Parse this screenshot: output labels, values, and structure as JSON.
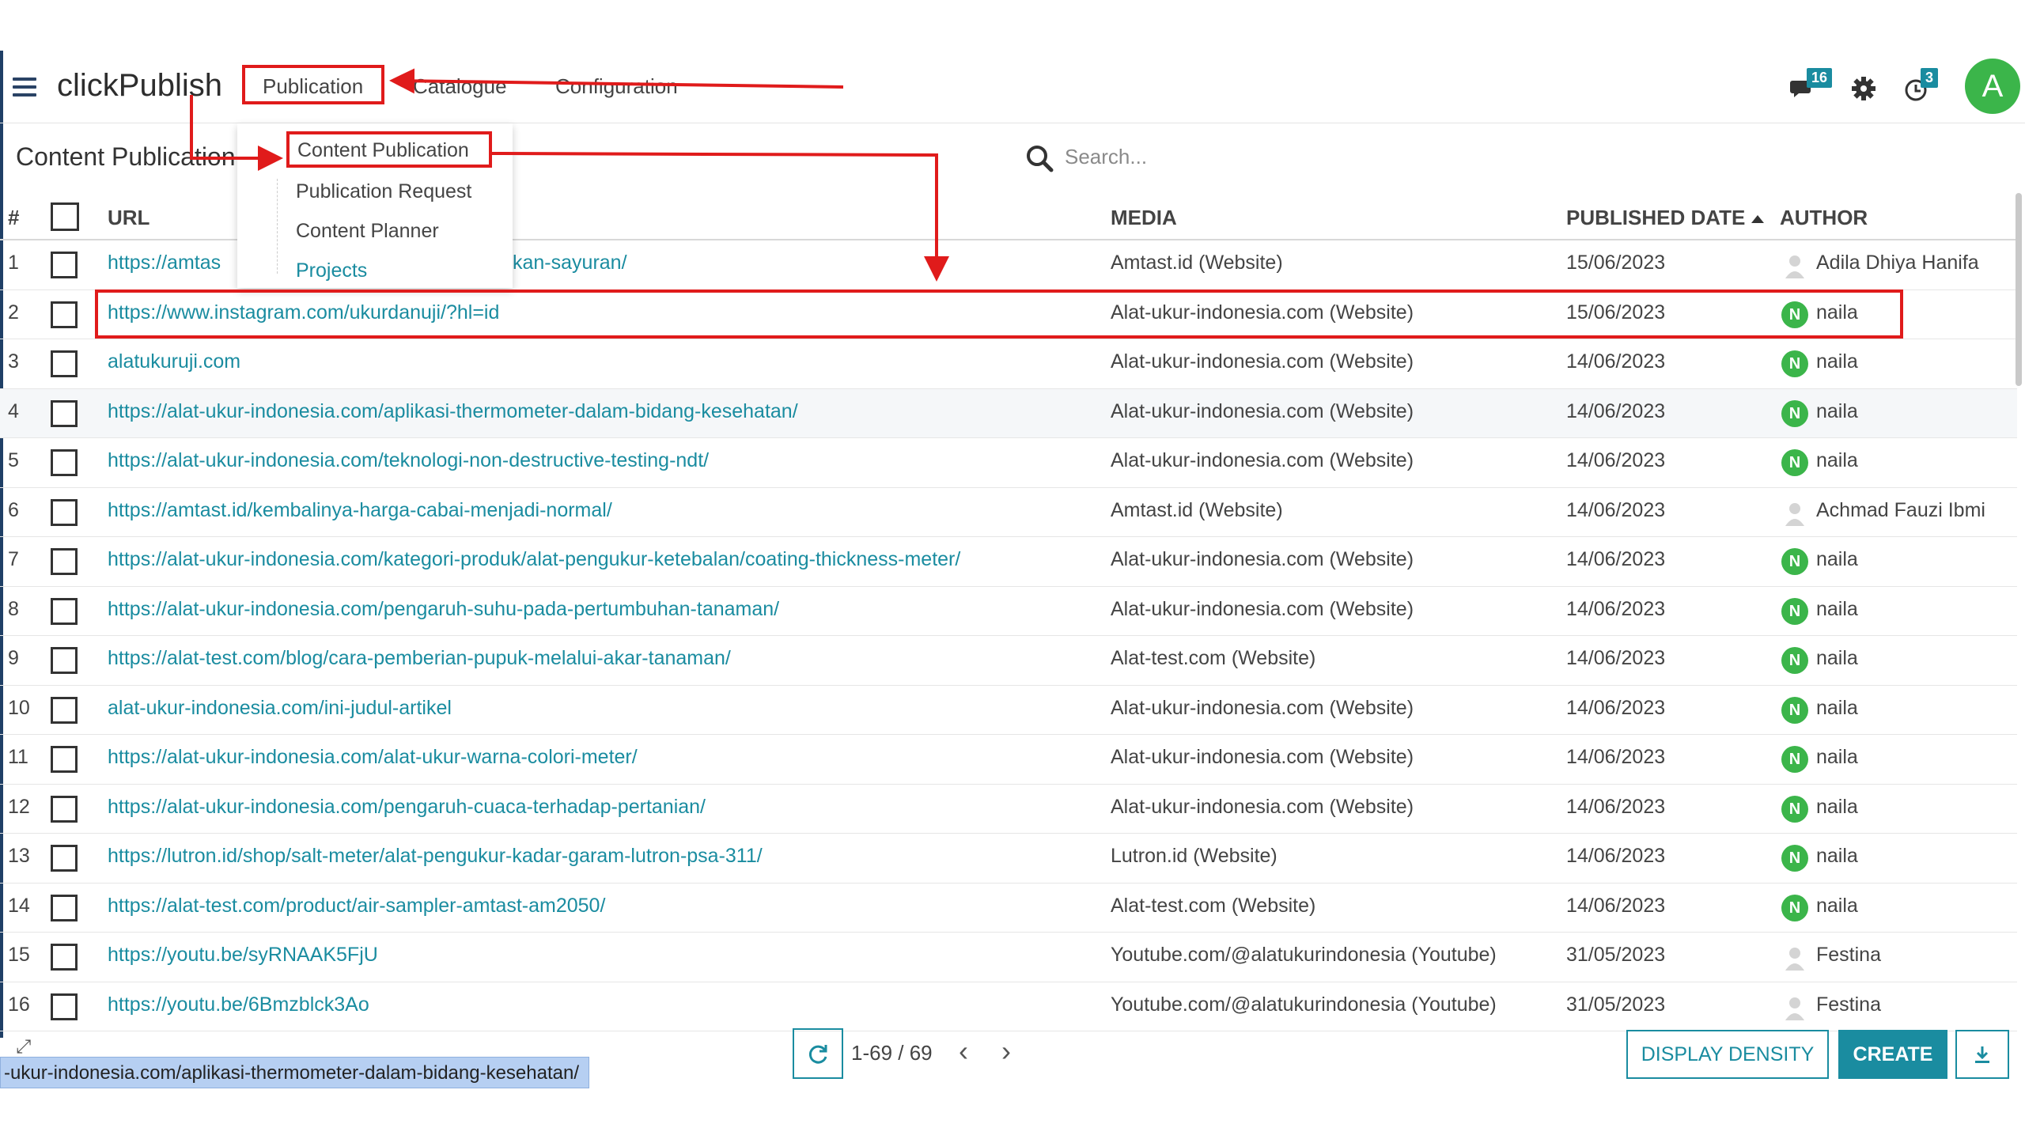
{
  "app": {
    "brand": "clickPublish",
    "nav": [
      {
        "label": "Publication"
      },
      {
        "label": "Catalogue"
      },
      {
        "label": "Configuration"
      }
    ],
    "chat_badge": "16",
    "activity_badge": "3",
    "avatar_letter": "A"
  },
  "page": {
    "title": "Content Publication",
    "search_placeholder": "Search..."
  },
  "dropdown": {
    "items": [
      {
        "label": "Content Publication"
      },
      {
        "label": "Publication Request"
      },
      {
        "label": "Content Planner"
      },
      {
        "label": "Projects"
      }
    ]
  },
  "table": {
    "headers": {
      "num": "#",
      "url": "URL",
      "media": "MEDIA",
      "date": "PUBLISHED DATE",
      "author": "AUTHOR"
    },
    "rows": [
      {
        "num": "1",
        "url": "https://amtas",
        "url_tail": "kan-sayuran/",
        "media": "Amtast.id (Website)",
        "date": "15/06/2023",
        "author": "Adila Dhiya Hanifa",
        "avatar": "user",
        "avatar_letter": ""
      },
      {
        "num": "2",
        "url": "https://www.instagram.com/ukurdanuji/?hl=id",
        "url_tail": "",
        "media": "Alat-ukur-indonesia.com (Website)",
        "date": "15/06/2023",
        "author": "naila",
        "avatar": "N",
        "avatar_letter": "N"
      },
      {
        "num": "3",
        "url": "alatukuruji.com",
        "url_tail": "",
        "media": "Alat-ukur-indonesia.com (Website)",
        "date": "14/06/2023",
        "author": "naila",
        "avatar": "N",
        "avatar_letter": "N"
      },
      {
        "num": "4",
        "url": "https://alat-ukur-indonesia.com/aplikasi-thermometer-dalam-bidang-kesehatan/",
        "url_tail": "",
        "media": "Alat-ukur-indonesia.com (Website)",
        "date": "14/06/2023",
        "author": "naila",
        "avatar": "N",
        "avatar_letter": "N"
      },
      {
        "num": "5",
        "url": "https://alat-ukur-indonesia.com/teknologi-non-destructive-testing-ndt/",
        "url_tail": "",
        "media": "Alat-ukur-indonesia.com (Website)",
        "date": "14/06/2023",
        "author": "naila",
        "avatar": "N",
        "avatar_letter": "N"
      },
      {
        "num": "6",
        "url": "https://amtast.id/kembalinya-harga-cabai-menjadi-normal/",
        "url_tail": "",
        "media": "Amtast.id (Website)",
        "date": "14/06/2023",
        "author": "Achmad Fauzi Ibmi",
        "avatar": "user",
        "avatar_letter": ""
      },
      {
        "num": "7",
        "url": "https://alat-ukur-indonesia.com/kategori-produk/alat-pengukur-ketebalan/coating-thickness-meter/",
        "url_tail": "",
        "media": "Alat-ukur-indonesia.com (Website)",
        "date": "14/06/2023",
        "author": "naila",
        "avatar": "N",
        "avatar_letter": "N"
      },
      {
        "num": "8",
        "url": "https://alat-ukur-indonesia.com/pengaruh-suhu-pada-pertumbuhan-tanaman/",
        "url_tail": "",
        "media": "Alat-ukur-indonesia.com (Website)",
        "date": "14/06/2023",
        "author": "naila",
        "avatar": "N",
        "avatar_letter": "N"
      },
      {
        "num": "9",
        "url": "https://alat-test.com/blog/cara-pemberian-pupuk-melalui-akar-tanaman/",
        "url_tail": "",
        "media": "Alat-test.com (Website)",
        "date": "14/06/2023",
        "author": "naila",
        "avatar": "N",
        "avatar_letter": "N"
      },
      {
        "num": "10",
        "url": "alat-ukur-indonesia.com/ini-judul-artikel",
        "url_tail": "",
        "media": "Alat-ukur-indonesia.com (Website)",
        "date": "14/06/2023",
        "author": "naila",
        "avatar": "N",
        "avatar_letter": "N"
      },
      {
        "num": "11",
        "url": "https://alat-ukur-indonesia.com/alat-ukur-warna-colori-meter/",
        "url_tail": "",
        "media": "Alat-ukur-indonesia.com (Website)",
        "date": "14/06/2023",
        "author": "naila",
        "avatar": "N",
        "avatar_letter": "N"
      },
      {
        "num": "12",
        "url": "https://alat-ukur-indonesia.com/pengaruh-cuaca-terhadap-pertanian/",
        "url_tail": "",
        "media": "Alat-ukur-indonesia.com (Website)",
        "date": "14/06/2023",
        "author": "naila",
        "avatar": "N",
        "avatar_letter": "N"
      },
      {
        "num": "13",
        "url": "https://lutron.id/shop/salt-meter/alat-pengukur-kadar-garam-lutron-psa-311/",
        "url_tail": "",
        "media": "Lutron.id (Website)",
        "date": "14/06/2023",
        "author": "naila",
        "avatar": "N",
        "avatar_letter": "N"
      },
      {
        "num": "14",
        "url": "https://alat-test.com/product/air-sampler-amtast-am2050/",
        "url_tail": "",
        "media": "Alat-test.com (Website)",
        "date": "14/06/2023",
        "author": "naila",
        "avatar": "N",
        "avatar_letter": "N"
      },
      {
        "num": "15",
        "url": "https://youtu.be/syRNAAK5FjU",
        "url_tail": "",
        "media": "Youtube.com/@alatukurindonesia (Youtube)",
        "date": "31/05/2023",
        "author": "Festina",
        "avatar": "user",
        "avatar_letter": ""
      },
      {
        "num": "16",
        "url": "https://youtu.be/6Bmzblck3Ao",
        "url_tail": "",
        "media": "Youtube.com/@alatukurindonesia (Youtube)",
        "date": "31/05/2023",
        "author": "Festina",
        "avatar": "user",
        "avatar_letter": ""
      }
    ]
  },
  "footer": {
    "pager": "1-69 / 69",
    "display_density": "DISPLAY DENSITY",
    "create": "CREATE",
    "status_url": "-ukur-indonesia.com/aplikasi-thermometer-dalam-bidang-kesehatan/"
  },
  "colors": {
    "accent": "#1a8ca0",
    "annotation": "#e01b1b",
    "avatar_green": "#3bb54a"
  }
}
